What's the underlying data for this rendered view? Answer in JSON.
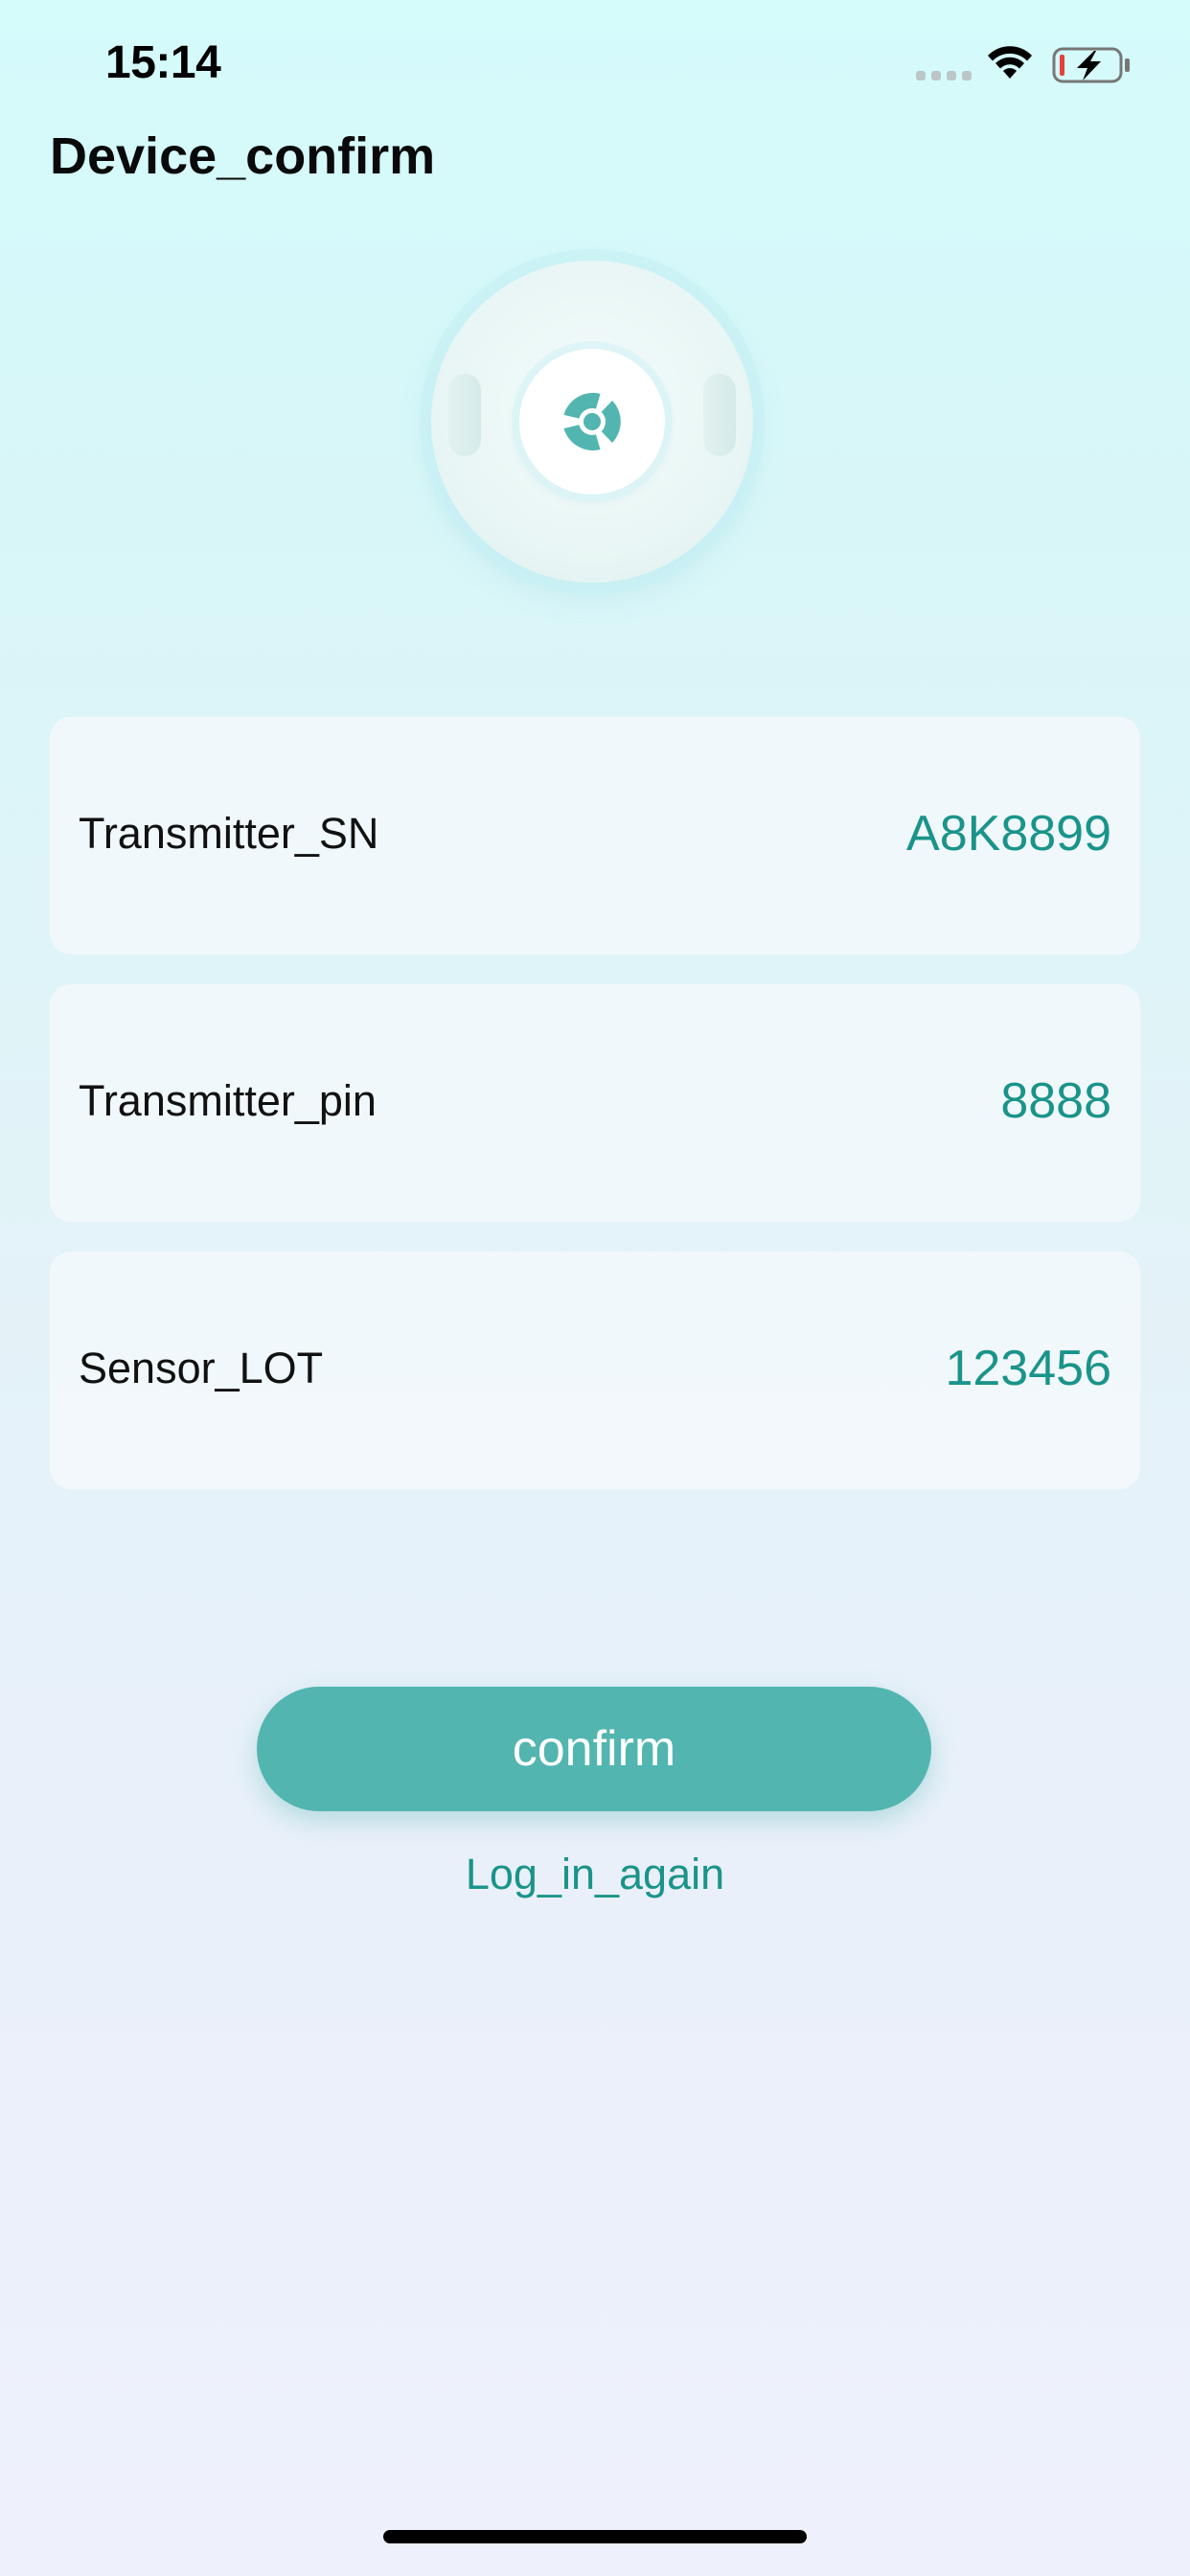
{
  "status_bar": {
    "time": "15:14",
    "signal_icon": "signal-dots-icon",
    "wifi_icon": "wifi-icon",
    "battery_icon": "battery-charging-icon"
  },
  "header": {
    "title": "Device_confirm"
  },
  "device": {
    "icon": "fan-icon",
    "accent_color": "#52b5b0"
  },
  "fields": [
    {
      "label": "Transmitter_SN",
      "value": "A8K8899"
    },
    {
      "label": "Transmitter_pin",
      "value": "8888"
    },
    {
      "label": "Sensor_LOT",
      "value": "123456"
    }
  ],
  "actions": {
    "confirm_label": "confirm",
    "login_again_label": "Log_in_again"
  },
  "colors": {
    "accent": "#52b5b0",
    "value_text": "#1a948a",
    "battery_low": "#e0443a"
  }
}
